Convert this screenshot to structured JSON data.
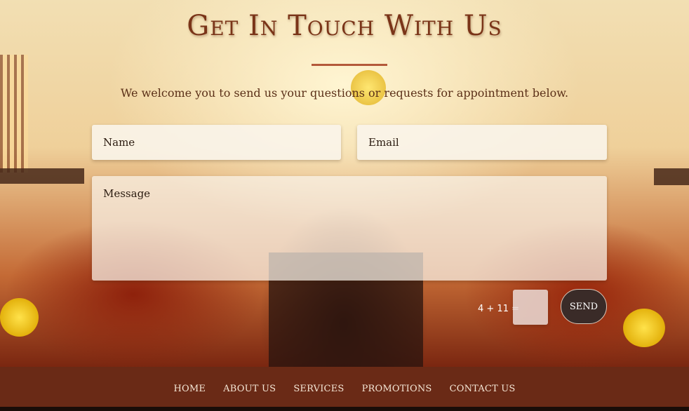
{
  "header": {
    "title": "Get In Touch With Us",
    "subtitle": "We welcome you to send us your questions or requests for appointment below."
  },
  "form": {
    "name_placeholder": "Name",
    "email_placeholder": "Email",
    "message_placeholder": "Message",
    "captcha_question": "4 + 11 =",
    "captcha_value": "",
    "send_label": "SEND"
  },
  "footer": {
    "nav": [
      "HOME",
      "ABOUT US",
      "SERVICES",
      "PROMOTIONS",
      "CONTACT US"
    ]
  },
  "colors": {
    "title": "#7a3418",
    "accent_rule": "#b4593a",
    "footer_bg": "#6a2a16",
    "button_bg": "#3a2b28"
  }
}
